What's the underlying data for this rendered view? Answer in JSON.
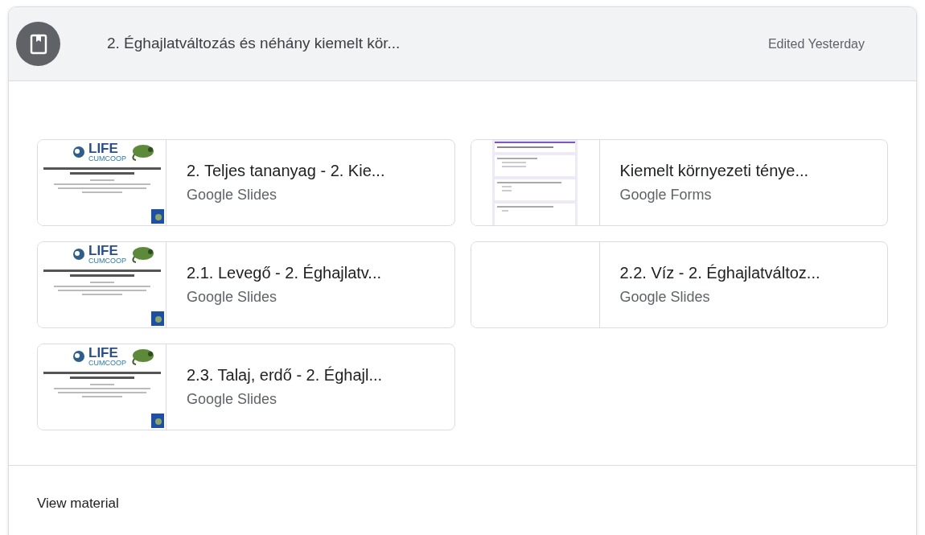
{
  "header": {
    "title": "2. Éghajlatváltozás és néhány kiemelt kör...",
    "edited": "Edited Yesterday"
  },
  "attachments": [
    {
      "title": "2. Teljes tananyag - 2. Kie...",
      "type": "Google Slides",
      "thumbnail": {
        "kind": "slides",
        "logo": "LIFE",
        "sublogo": "CUMCOOP"
      }
    },
    {
      "title": "Kiemelt környezeti ténye...",
      "type": "Google Forms",
      "thumbnail": {
        "kind": "form"
      }
    },
    {
      "title": "2.1. Levegő - 2. Éghajlatv...",
      "type": "Google Slides",
      "thumbnail": {
        "kind": "slides",
        "logo": "LIFE",
        "sublogo": "CUMCOOP"
      }
    },
    {
      "title": "2.2. Víz - 2. Éghajlatváltoz...",
      "type": "Google Slides",
      "thumbnail": {
        "kind": "blank"
      }
    },
    {
      "title": "2.3. Talaj, erdő - 2. Éghajl...",
      "type": "Google Slides",
      "thumbnail": {
        "kind": "slides",
        "logo": "LIFE",
        "sublogo": "CUMCOOP"
      }
    }
  ],
  "footer": {
    "link": "View material"
  }
}
